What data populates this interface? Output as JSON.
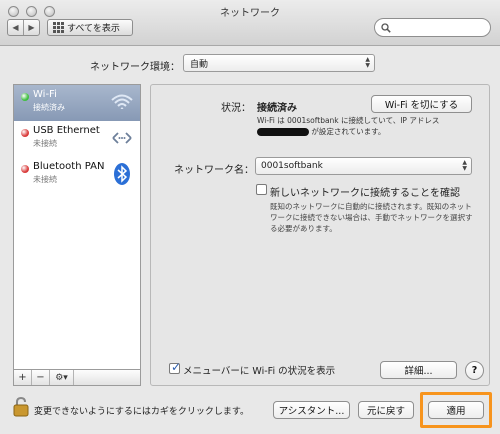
{
  "window": {
    "title": "ネットワーク"
  },
  "toolbar": {
    "back_icon": "◀",
    "forward_icon": "▶",
    "show_all_label": "すべてを表示",
    "search_placeholder": ""
  },
  "location": {
    "label": "ネットワーク環境：",
    "value": "自動"
  },
  "services": [
    {
      "name": "Wi-Fi",
      "status": "接続済み",
      "dot_color": "#3fbf3f",
      "icon": "wifi-icon"
    },
    {
      "name": "USB Ethernet",
      "status": "未接続",
      "dot_color": "#d93a3a",
      "icon": "ethernet-icon"
    },
    {
      "name": "Bluetooth PAN",
      "status": "未接続",
      "dot_color": "#d93a3a",
      "icon": "bluetooth-icon"
    }
  ],
  "sidebar_buttons": {
    "add": "+",
    "remove": "−",
    "gear": "⚙▾"
  },
  "detail": {
    "status_label": "状況：",
    "status_value": "接続済み",
    "toggle_wifi_label": "Wi-Fi を切にする",
    "status_description_pre": "Wi-Fi は 0001softbank に接続していて、IP アドレス",
    "status_description_post": "が設定されています。",
    "network_name_label": "ネットワーク名：",
    "network_name_value": "0001softbank",
    "ask_to_join_label": "新しいネットワークに接続することを確認",
    "ask_to_join_help": "既知のネットワークに自動的に接続されます。既知のネットワークに接続できない場合は、手動でネットワークを選択する必要があります。",
    "show_in_menubar_label": "メニューバーに Wi-Fi の状況を表示",
    "advanced_label": "詳細...",
    "help_label": "?"
  },
  "footer": {
    "lock_text": "変更できないようにするにはカギをクリックします。",
    "assistant_label": "アシスタント...",
    "revert_label": "元に戻す",
    "apply_label": "適用"
  },
  "colors": {
    "highlight": "#f7941d",
    "selection": "#8799b5"
  }
}
